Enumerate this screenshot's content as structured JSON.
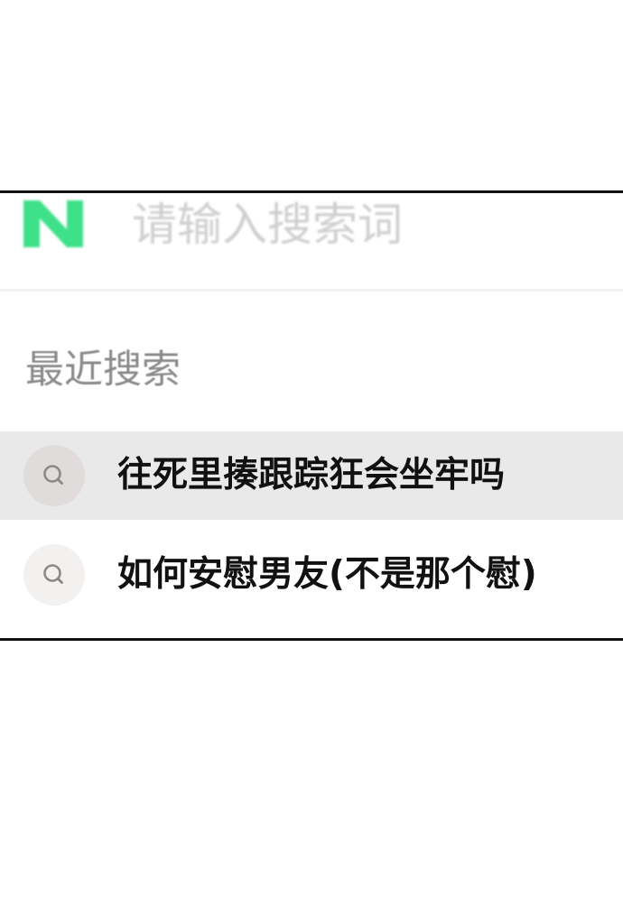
{
  "search": {
    "placeholder": "请输入搜索词",
    "logo_icon": "n-logo-icon",
    "logo_letter": "N",
    "logo_color": "#3ee08a"
  },
  "recent": {
    "title": "最近搜索",
    "items": [
      {
        "text": "往死里揍跟踪狂会坐牢吗",
        "icon": "search-icon",
        "highlighted": true
      },
      {
        "text": "如何安慰男友(不是那个慰)",
        "icon": "search-icon",
        "highlighted": false
      }
    ]
  },
  "colors": {
    "frame_border": "#111111",
    "highlight_row": "#e9e9e9",
    "section_title": "#8a8a8a",
    "placeholder": "#cfcfcf"
  }
}
